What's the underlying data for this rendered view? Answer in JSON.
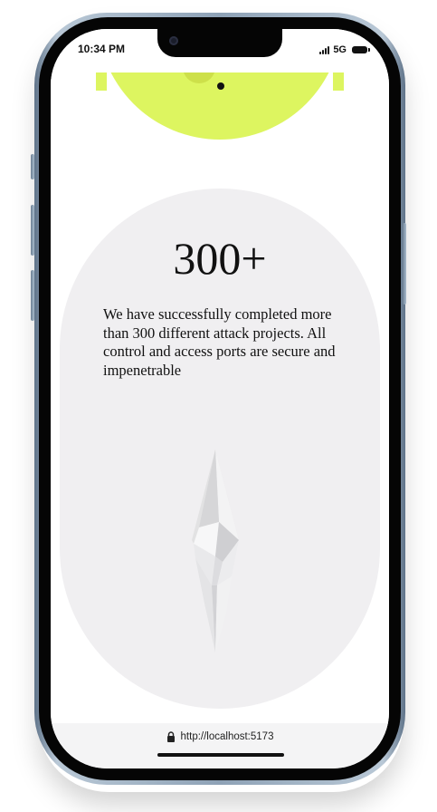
{
  "status_bar": {
    "time": "10:34 PM",
    "network": "5G",
    "icons": [
      "signal-bars-icon",
      "battery-icon"
    ]
  },
  "stat": {
    "number": "300+",
    "description": "We have successfully completed more than 300 different attack projects. All control and access ports are secure and impenetrable"
  },
  "browser": {
    "url": "http://localhost:5173",
    "icons": [
      "lock-icon"
    ]
  },
  "colors": {
    "accent": "#ddf560",
    "card_background": "#f0eff1",
    "text": "#111111"
  }
}
